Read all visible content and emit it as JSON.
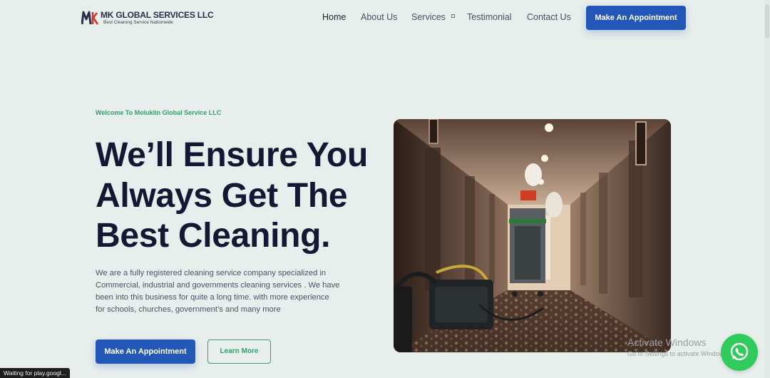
{
  "brand": {
    "name": "MK GLOBAL SERVICES LLC",
    "tagline": "Best Cleaning Service Nationwide",
    "mark": "MK"
  },
  "nav": {
    "items": [
      {
        "label": "Home"
      },
      {
        "label": "About Us"
      },
      {
        "label": "Services"
      },
      {
        "label": "Testimonial"
      },
      {
        "label": "Contact Us"
      }
    ],
    "cta_label": "Make An Appointment"
  },
  "hero": {
    "eyebrow": "Welcome To Moluklin Global Service LLC",
    "title_lines": [
      "We’ll Ensure You",
      "Always Get The",
      "Best Cleaning."
    ],
    "body_lines": [
      "We are a fully registered cleaning service company specialized in",
      "Commercial, industrial and governments cleaning services . We have",
      "been into this business for quite a long time. with more experience",
      "for schools, churches, government’s and many more"
    ],
    "primary_cta": "Make An Appointment",
    "secondary_cta": "Learn More"
  },
  "watermark": {
    "title": "Activate Windows",
    "subtitle": "Go to Settings to activate Windows."
  },
  "status_bar": {
    "text": "Waiting for play.googl..."
  },
  "colors": {
    "background": "#e7eeec",
    "primary": "#2257b7",
    "accent_green": "#2ea36b",
    "heading": "#131833",
    "whatsapp": "#2fcc5b"
  },
  "icons": {
    "whatsapp": "whatsapp-icon",
    "dropdown": "chevron-down-icon"
  }
}
